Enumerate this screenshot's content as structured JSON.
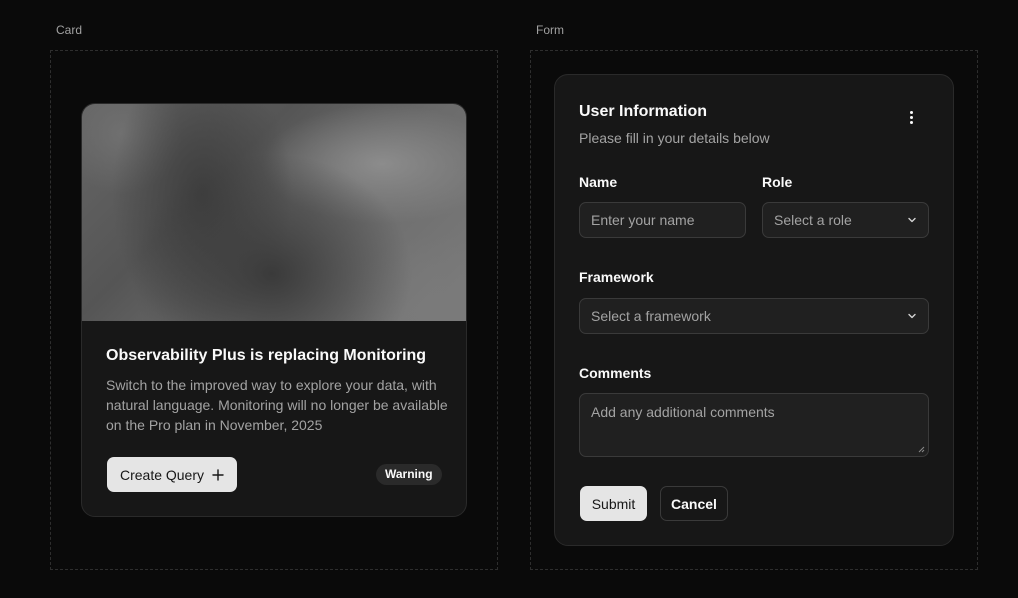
{
  "card_section": {
    "label": "Card",
    "title": "Observability Plus is replacing Monitoring",
    "description": "Switch to the improved way to explore your data, with natural language. Monitoring will no longer be available on the Pro plan in November, 2025",
    "create_button_label": "Create Query",
    "create_button_icon": "plus-icon",
    "badge": "Warning"
  },
  "form_section": {
    "label": "Form",
    "title": "User Information",
    "subtitle": "Please fill in your details below",
    "menu_icon": "more-vertical-icon",
    "name": {
      "label": "Name",
      "placeholder": "Enter your name",
      "value": ""
    },
    "role": {
      "label": "Role",
      "selected": "Select a role"
    },
    "framework": {
      "label": "Framework",
      "selected": "Select a framework"
    },
    "comments": {
      "label": "Comments",
      "placeholder": "Add any additional comments",
      "value": ""
    },
    "submit_label": "Submit",
    "cancel_label": "Cancel"
  },
  "colors": {
    "background": "#0a0a0a",
    "card": "#171717",
    "primary_button": "#e5e5e5",
    "muted_text": "#a3a3a3"
  }
}
